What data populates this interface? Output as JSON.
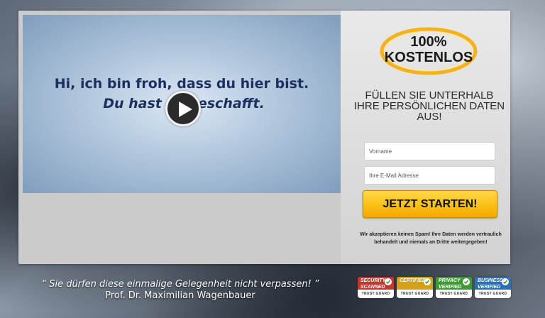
{
  "video": {
    "line1": "Hi, ich bin froh, dass du hier bist.",
    "line2": "Du hast es geschafft."
  },
  "badge": {
    "top": "100%",
    "bottom": "KOSTENLOS"
  },
  "form": {
    "headline": "FÜLLEN SIE UNTERHALB IHRE PERSÖNLICHEN DATEN AUS!",
    "firstname_placeholder": "Vorname",
    "email_placeholder": "Ihre E-Mail Adresse",
    "submit_label": "JETZT STARTEN!",
    "privacy_note": "Wir akzeptieren keinen Spam! Ihre Daten werden vertraulich behandelt und niemals an Dritte weitergegeben!"
  },
  "testimonial": {
    "quote": "“ Sie dürfen diese einmalige Gelegenheit nicht verpassen! ”",
    "author": "Prof. Dr. Maximilian Wagenbauer"
  },
  "seals": [
    {
      "label": "SECURITY",
      "sub": "SCANNED",
      "footer": "TRUST GUARD",
      "color": "#c0392b"
    },
    {
      "label": "CERTIFIED",
      "sub": "",
      "footer": "TRUST GUARD",
      "color": "#d4a017"
    },
    {
      "label": "PRIVACY",
      "sub": "VERIFIED",
      "footer": "TRUST GUARD",
      "color": "#3f9a36"
    },
    {
      "label": "BUSINESS",
      "sub": "VERIFIED",
      "footer": "TRUST GUARD",
      "color": "#2a6fb8"
    }
  ],
  "colors": {
    "badge_ring": "#f5b21a",
    "cta": "#fbc21a",
    "video_text": "#1d2f5e"
  },
  "icons": {
    "play": "play-icon",
    "seal_check": "checkmark-icon"
  }
}
